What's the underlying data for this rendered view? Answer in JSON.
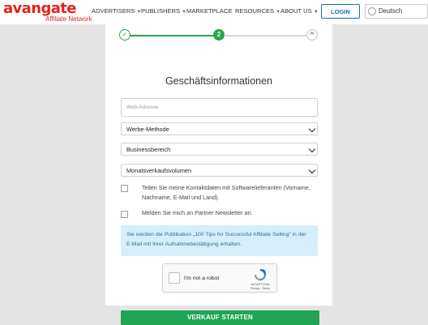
{
  "header": {
    "logo_text": "avangate",
    "logo_sub": "Affiliate Network",
    "nav": [
      {
        "label": "ADVERTISERS",
        "has_caret": true
      },
      {
        "label": "PUBLISHERS",
        "has_caret": true
      },
      {
        "label": "MARKETPLACE",
        "has_caret": false
      },
      {
        "label": "RESOURCES",
        "has_caret": true
      },
      {
        "label": "ABOUT US",
        "has_caret": true
      }
    ],
    "login_label": "LOGIN",
    "language": "Deutsch"
  },
  "stepper": {
    "step1_icon": "check-icon",
    "step2_label": "2",
    "step3_icon": "flag-icon"
  },
  "form": {
    "title": "Geschäftsinformationen",
    "web_address_placeholder": "Web-Adresse",
    "select_method": "Werbe-Methode",
    "select_business": "Businessbereich",
    "select_volume": "Monatsverkaufsvolumen",
    "checkbox_share": "Teilen Sie meine Kontaktdaten mit Softwarelieferanten (Vorname, Nachname, E-Mail und Land).",
    "checkbox_newsletter": "Melden Sie mich an Partner Newsletter an.",
    "info_text": "Sie werden die Publikation „100 Tips for Successful Affiliate Selling“ in der E-Mail mit Ihrer Aufnahmebestätigung erhalten.",
    "captcha_text": "I'm not a robot",
    "captcha_brand": "reCAPTCHA",
    "captcha_links": "Privacy - Terms",
    "submit_label": "VERKAUF STARTEN"
  },
  "colors": {
    "brand": "#e2231a",
    "accent_green": "#27a749",
    "login_blue": "#1c6bb0",
    "info_bg": "#d5eefb"
  }
}
